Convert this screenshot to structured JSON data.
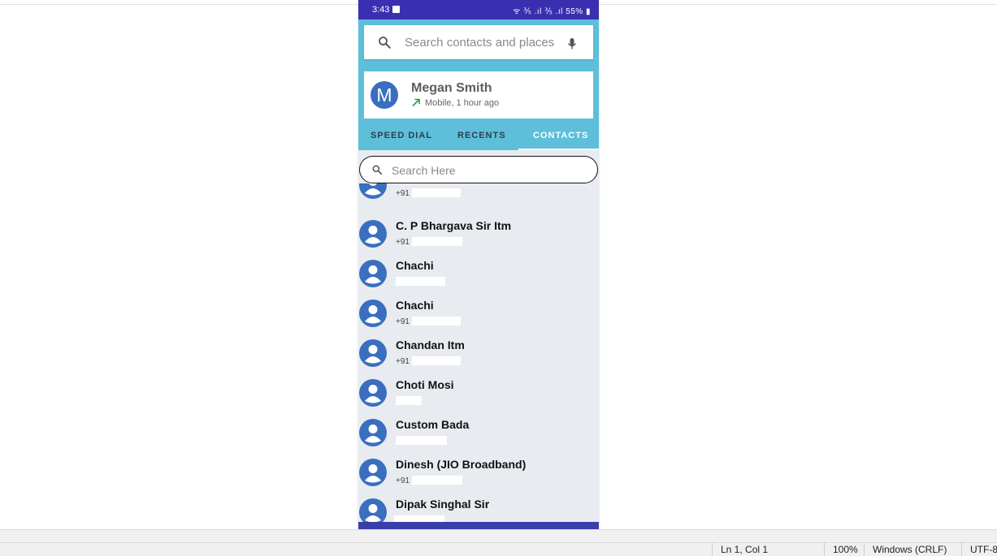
{
  "phone": {
    "status_bar": {
      "time": "3:43",
      "indicators": "ᯤ ⅗ .ıl ⅗ .ıl",
      "battery": "55%"
    },
    "search": {
      "placeholder": "Search contacts and places",
      "search_icon": "search-icon",
      "mic_icon": "microphone-icon"
    },
    "recent_call": {
      "avatar_letter": "M",
      "name": "Megan Smith",
      "detail": "Mobile, 1 hour ago",
      "call_icon": "outgoing-call-arrow-icon"
    },
    "tabs": [
      {
        "label": "SPEED DIAL",
        "active": false
      },
      {
        "label": "RECENTS",
        "active": false
      },
      {
        "label": "CONTACTS",
        "active": true
      }
    ],
    "list_search": {
      "placeholder": "Search Here"
    },
    "contacts": [
      {
        "name": "",
        "phone": "+91"
      },
      {
        "name": "C. P Bhargava Sir Itm",
        "phone": "+91"
      },
      {
        "name": "Chachi",
        "phone": ""
      },
      {
        "name": "Chachi",
        "phone": "+91"
      },
      {
        "name": "Chandan Itm",
        "phone": "+91"
      },
      {
        "name": "Choti Mosi",
        "phone": ""
      },
      {
        "name": "Custom Bada",
        "phone": ""
      },
      {
        "name": "Dinesh (JIO Broadband)",
        "phone": "+91"
      },
      {
        "name": "Dipak Singhal Sir",
        "phone": ""
      }
    ],
    "nav": {
      "back_icon": "back-chevron-icon",
      "home_icon": "home-circle-icon",
      "recents_icon": "menu-lines-icon"
    }
  },
  "desktop_status": {
    "position": "Ln 1, Col 1",
    "zoom": "100%",
    "line_ending": "Windows (CRLF)",
    "encoding": "UTF-8"
  },
  "colors": {
    "status_bar": "#3a2fb0",
    "header": "#5dbfda",
    "avatar": "#3a6fbf",
    "nav_bar": "#3a3fa8"
  }
}
